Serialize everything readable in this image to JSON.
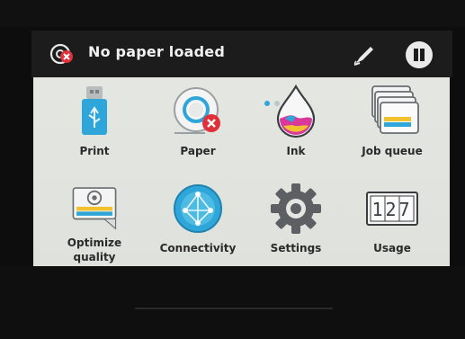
{
  "status": {
    "icon": "paper-error-icon",
    "message": "No paper loaded"
  },
  "header": {
    "pen_icon": "pen-icon",
    "pause_icon": "pause-icon"
  },
  "tiles": [
    {
      "label": "Print",
      "icon": "usb-drive-icon"
    },
    {
      "label": "Paper",
      "icon": "paper-roll-error-icon"
    },
    {
      "label": "Ink",
      "icon": "ink-drop-icon"
    },
    {
      "label": "Job queue",
      "icon": "job-stack-icon"
    },
    {
      "label": "Optimize quality",
      "icon": "optimize-quality-icon"
    },
    {
      "label": "Connectivity",
      "icon": "network-globe-icon"
    },
    {
      "label": "Settings",
      "icon": "gear-icon"
    },
    {
      "label": "Usage",
      "icon": "counter-icon"
    }
  ],
  "usage_counter": "127",
  "colors": {
    "error_red": "#e0303a",
    "accent_blue": "#2ea6d9",
    "panel_bg": "#e2e4e0"
  }
}
